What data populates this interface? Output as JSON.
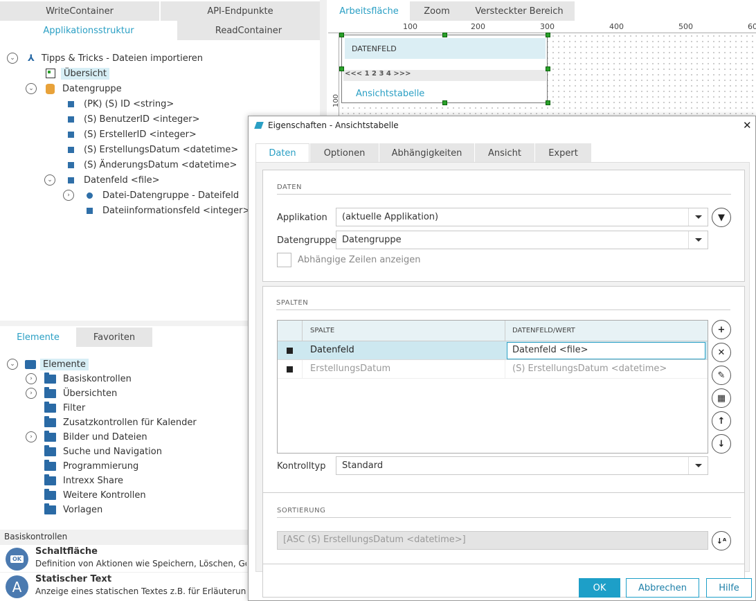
{
  "top_tabs": {
    "write": "WriteContainer",
    "api": "API-Endpunkte",
    "app_struct": "Applikationsstruktur",
    "read": "ReadContainer"
  },
  "tree": {
    "root": "Tipps & Tricks - Dateien importieren",
    "overview": "Übersicht",
    "datagroup": "Datengruppe",
    "fields": [
      "(PK) (S) ID <string>",
      "(S) BenutzerID <integer>",
      "(S) ErstellerID <integer>",
      "(S) ErstellungsDatum <datetime>",
      "(S) ÄnderungsDatum <datetime>",
      "Datenfeld <file>"
    ],
    "subfields": [
      "Datei-Datengruppe - Dateifeld",
      "Dateiinformationsfeld <integer>"
    ]
  },
  "canvas": {
    "tabs": [
      "Arbeitsfläche",
      "Zoom",
      "Versteckter Bereich"
    ],
    "ruler_x": [
      "100",
      "200",
      "300",
      "400",
      "500",
      "600"
    ],
    "ruler_y": [
      "100"
    ],
    "datenfeld_label": "DATENFELD",
    "pager": "<<< 1 2 3 4 >>>",
    "view_table_label": "Ansichtstabelle"
  },
  "elements": {
    "tabs": [
      "Elemente",
      "Favoriten"
    ],
    "root": "Elemente",
    "items": [
      "Basiskontrollen",
      "Übersichten",
      "Filter",
      "Zusatzkontrollen für Kalender",
      "Bilder und Dateien",
      "Suche und Navigation",
      "Programmierung",
      "Intrexx Share",
      "Weitere Kontrollen",
      "Vorlagen"
    ]
  },
  "basics": {
    "header": "Basiskontrollen",
    "items": [
      {
        "icon_text": "OK",
        "title": "Schaltfläche",
        "desc": "Definition von Aktionen wie Speichern, Löschen, Gehe"
      },
      {
        "icon_text": "A",
        "title": "Statischer Text",
        "desc": "Anzeige eines statischen Textes z.B. für Erläuterungs"
      }
    ]
  },
  "dialog": {
    "title": "Eigenschaften - Ansichtstabelle",
    "close": "✕",
    "tabs": [
      "Daten",
      "Optionen",
      "Abhängigkeiten",
      "Ansicht",
      "Expert"
    ],
    "daten": {
      "section": "DATEN",
      "app_label": "Applikation",
      "app_value": "(aktuelle Applikation)",
      "dg_label": "Datengruppe",
      "dg_value": "Datengruppe",
      "checkbox_label": "Abhängige Zeilen anzeigen"
    },
    "spalten": {
      "section": "SPALTEN",
      "headers": [
        "SPALTE",
        "DATENFELD/WERT"
      ],
      "rows": [
        [
          "Datenfeld",
          "Datenfeld <file>"
        ],
        [
          "ErstellungsDatum",
          "(S) ErstellungsDatum <datetime>"
        ]
      ],
      "control_label": "Kontrolltyp",
      "control_value": "Standard"
    },
    "sortierung": {
      "section": "SORTIERUNG",
      "value": "[ASC (S) ErstellungsDatum <datetime>]"
    },
    "buttons": {
      "ok": "OK",
      "cancel": "Abbrechen",
      "help": "Hilfe"
    },
    "side_icons": [
      "plus-icon",
      "remove-icon",
      "edit-icon",
      "calculator-icon",
      "arrow-up-icon",
      "arrow-down-icon"
    ],
    "colors": {
      "accent": "#2a9fc4",
      "ok_bg": "#1d9fc8",
      "selected_row": "#cde8f0",
      "header_bg": "#e7f2f5"
    }
  }
}
